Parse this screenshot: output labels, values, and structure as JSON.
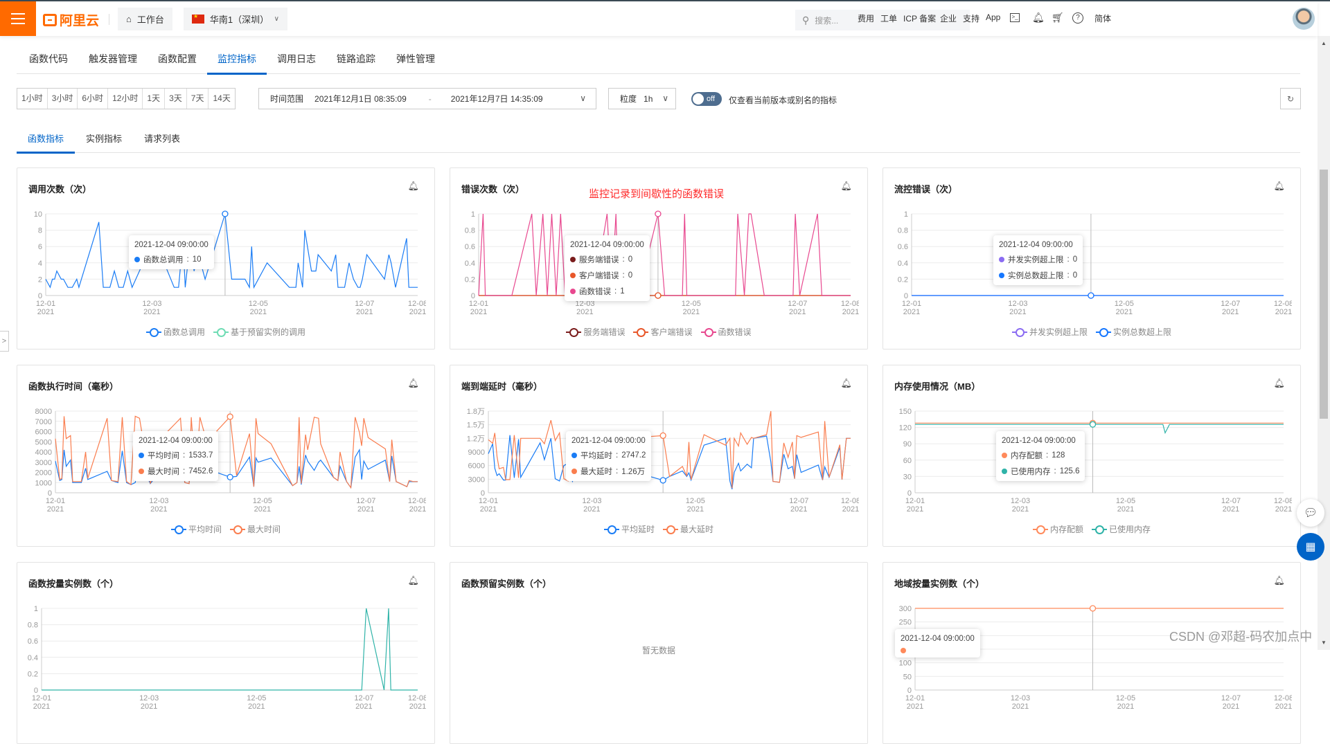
{
  "header": {
    "logo_text": "阿里云",
    "workbench": "工作台",
    "region": "华南1（深圳）",
    "search_placeholder": "搜索...",
    "nav": [
      "费用",
      "工单",
      "ICP 备案",
      "企业",
      "支持",
      "App"
    ],
    "language": "简体",
    "icons": [
      "terminal-icon",
      "bell-icon",
      "cart-icon",
      "help-icon"
    ]
  },
  "tabs": [
    {
      "label": "函数代码",
      "active": false
    },
    {
      "label": "触发器管理",
      "active": false
    },
    {
      "label": "函数配置",
      "active": false
    },
    {
      "label": "监控指标",
      "active": true
    },
    {
      "label": "调用日志",
      "active": false
    },
    {
      "label": "链路追踪",
      "active": false
    },
    {
      "label": "弹性管理",
      "active": false
    }
  ],
  "toolbar": {
    "quick_ranges": [
      "1小时",
      "3小时",
      "6小时",
      "12小时",
      "1天",
      "3天",
      "7天",
      "14天"
    ],
    "range_label": "时间范围",
    "range_start": "2021年12月1日 08:35:09",
    "range_sep": "-",
    "range_end": "2021年12月7日 14:35:09",
    "granularity_label": "粒度",
    "granularity_value": "1h",
    "toggle_state": "off",
    "toggle_label": "仅查看当前版本或别名的指标"
  },
  "subtabs": [
    {
      "label": "函数指标",
      "active": true
    },
    {
      "label": "实例指标",
      "active": false
    },
    {
      "label": "请求列表",
      "active": false
    }
  ],
  "watermark": "CSDN @邓超-码农加点中",
  "chart_data": [
    {
      "type": "line",
      "title": "调用次数（次）",
      "ylim": [
        0,
        10
      ],
      "yticks": [
        "0",
        "2",
        "4",
        "6",
        "8",
        "10"
      ],
      "xticks": [
        {
          "date": "2021-12-01",
          "l1": "12-01",
          "l2": "2021"
        },
        {
          "date": "2021-12-03",
          "l1": "12-03",
          "l2": "2021"
        },
        {
          "date": "2021-12-05",
          "l1": "12-05",
          "l2": "2021"
        },
        {
          "date": "2021-12-07",
          "l1": "12-07",
          "l2": "2021"
        },
        {
          "date": "2021-12-08",
          "l1": "12-08",
          "l2": "2021"
        }
      ],
      "x": [
        "12-01 00:00",
        "12-01 02:00",
        "12-01 03:00",
        "12-01 04:00",
        "12-01 05:00",
        "12-01 07:00",
        "12-01 08:00",
        "12-01 10:00",
        "12-01 12:00",
        "12-01 14:00",
        "12-01 15:00",
        "12-02 00:00",
        "12-02 02:00",
        "12-02 05:00",
        "12-02 07:00",
        "12-02 09:00",
        "12-02 11:00",
        "12-02 13:00",
        "12-02 15:00",
        "12-02 20:00",
        "12-03 04:00",
        "12-03 10:00",
        "12-03 12:00",
        "12-03 14:00",
        "12-03 15:00",
        "12-03 17:00",
        "12-03 19:00",
        "12-03 21:00",
        "12-04 00:00",
        "12-04 09:00",
        "12-04 12:00",
        "12-04 18:00",
        "12-04 20:00",
        "12-04 21:00",
        "12-04 22:00",
        "12-05 04:00",
        "12-05 14:00",
        "12-05 16:00",
        "12-05 17:00",
        "12-05 18:00",
        "12-05 20:00",
        "12-05 21:00",
        "12-06 00:00",
        "12-06 02:00",
        "12-06 03:00",
        "12-06 09:00",
        "12-06 11:00",
        "12-06 12:00",
        "12-06 15:00",
        "12-06 17:00",
        "12-06 19:00",
        "12-06 21:00",
        "12-06 22:00",
        "12-06 23:00",
        "12-07 01:00",
        "12-07 09:00",
        "12-07 11:00",
        "12-07 12:00",
        "12-07 14:00",
        "12-07 19:00",
        "12-07 20:00",
        "12-07 22:00",
        "12-08 00:00"
      ],
      "series": [
        {
          "name": "函数总调用",
          "color": "#1a7cf5",
          "values": [
            2,
            1,
            2,
            2,
            3,
            2,
            2,
            1,
            1,
            2,
            1,
            9,
            1,
            1,
            3,
            1,
            1,
            3,
            1,
            4,
            5,
            1,
            1,
            7,
            1,
            6,
            3,
            5,
            2,
            10,
            2,
            2,
            1,
            6,
            1,
            4,
            1,
            1,
            1,
            4,
            1,
            8,
            3,
            3,
            5,
            3,
            5,
            1,
            1,
            4,
            2,
            1,
            1,
            2,
            5,
            2,
            5,
            4,
            1,
            7,
            1,
            1,
            1
          ]
        },
        {
          "name": "基于预留实例的调用",
          "color": "#6fdcb4",
          "values": []
        }
      ],
      "tooltip": {
        "time": "2021-12-04 09:00:00",
        "rows": [
          {
            "label": "函数总调用",
            "value": "10",
            "color": "#1a7cf5"
          }
        ]
      },
      "highlight": "12-04 09:00"
    },
    {
      "type": "line",
      "title": "错误次数（次）",
      "annotation": "监控记录到间歇性的函数错误",
      "ylim": [
        0,
        1
      ],
      "yticks": [
        "0",
        "0.2",
        "0.4",
        "0.6",
        "0.8",
        "1"
      ],
      "series": [
        {
          "name": "服务端错误",
          "color": "#7a1c1c",
          "values": "zeros"
        },
        {
          "name": "客户端错误",
          "color": "#e8572a",
          "values": "zeros"
        },
        {
          "name": "函数错误",
          "color": "#e8488f",
          "values": [
            0,
            1,
            0,
            0,
            0,
            0,
            0,
            0,
            0,
            0,
            0,
            1,
            0,
            1,
            0,
            1,
            0,
            1,
            0,
            0,
            0,
            1,
            0,
            1,
            0,
            0,
            0,
            0,
            0,
            1,
            0,
            0,
            0,
            1,
            0,
            0,
            0,
            0,
            0,
            0,
            0,
            1,
            0,
            1,
            1,
            0,
            0,
            0,
            0,
            0,
            0,
            0,
            0,
            1,
            0,
            1,
            0,
            0,
            0,
            0,
            0,
            0,
            0
          ]
        }
      ],
      "tooltip": {
        "time": "2021-12-04 09:00:00",
        "rows": [
          {
            "label": "服务端错误",
            "value": "0",
            "color": "#7a1c1c"
          },
          {
            "label": "客户端错误",
            "value": "0",
            "color": "#e8572a"
          },
          {
            "label": "函数错误",
            "value": "1",
            "color": "#e8488f"
          }
        ]
      },
      "highlight": "12-04 09:00"
    },
    {
      "type": "line",
      "title": "流控错误（次）",
      "ylim": [
        0,
        1
      ],
      "yticks": [
        "0",
        "0.2",
        "0.4",
        "0.6",
        "0.8",
        "1"
      ],
      "series": [
        {
          "name": "并发实例超上限",
          "color": "#8b6cf2",
          "values": "zeros"
        },
        {
          "name": "实例总数超上限",
          "color": "#1677ff",
          "values": "zeros"
        }
      ],
      "tooltip": {
        "time": "2021-12-04 09:00:00",
        "rows": [
          {
            "label": "并发实例超上限",
            "value": "0",
            "color": "#8b6cf2"
          },
          {
            "label": "实例总数超上限",
            "value": "0",
            "color": "#1677ff"
          }
        ]
      },
      "highlight": "12-04 09:00"
    },
    {
      "type": "line",
      "title": "函数执行时间（毫秒）",
      "ylim": [
        0,
        8000
      ],
      "yticks": [
        "0",
        "1000",
        "2000",
        "3000",
        "4000",
        "5000",
        "6000",
        "7000",
        "8000"
      ],
      "series": [
        {
          "name": "平均时间",
          "color": "#1a7cf5",
          "values": [
            3100,
            1200,
            1300,
            4200,
            2600,
            3200,
            1000,
            1000,
            1000,
            2400,
            1300,
            2100,
            1200,
            1000,
            4100,
            1000,
            800,
            1000,
            3200,
            900,
            3000,
            3200,
            1000,
            900,
            3000,
            1800,
            3400,
            2800,
            2200,
            1533.7,
            1600,
            3500,
            600,
            3400,
            3000,
            3400,
            700,
            1000,
            2600,
            800,
            3700,
            3100,
            2200,
            3000,
            3200,
            1500,
            1200,
            2600,
            1100,
            500,
            3500,
            4200,
            1300,
            3100,
            2300,
            3200,
            1100,
            3600,
            1100,
            600,
            1100,
            1100,
            1100
          ]
        },
        {
          "name": "最大时间",
          "color": "#fa7d4e",
          "values": [
            5300,
            1300,
            1400,
            7500,
            5300,
            5600,
            1100,
            1100,
            1100,
            4000,
            1400,
            7300,
            1200,
            1100,
            7400,
            1100,
            800,
            7500,
            7300,
            900,
            6000,
            7300,
            1000,
            900,
            7400,
            1300,
            7400,
            5900,
            5400,
            7452.6,
            1700,
            5800,
            600,
            7300,
            5800,
            4800,
            700,
            1000,
            7400,
            900,
            5700,
            4200,
            7400,
            7300,
            4800,
            1500,
            1200,
            4000,
            1100,
            500,
            7400,
            5900,
            4600,
            7300,
            5400,
            4300,
            1100,
            5200,
            1100,
            600,
            1200,
            1100,
            1100
          ]
        }
      ],
      "tooltip": {
        "time": "2021-12-04 09:00:00",
        "rows": [
          {
            "label": "平均时间",
            "value": "1533.7",
            "color": "#1a7cf5"
          },
          {
            "label": "最大时间",
            "value": "7452.6",
            "color": "#fa7d4e"
          }
        ]
      },
      "highlight": "12-04 09:00"
    },
    {
      "type": "line",
      "title": "端到端延时（毫秒）",
      "ylim": [
        0,
        18000
      ],
      "yticks": [
        "0",
        "3000",
        "6000",
        "9000",
        "1.2万",
        "1.5万",
        "1.8万"
      ],
      "series": [
        {
          "name": "平均延时",
          "color": "#1a7cf5",
          "values": [
            8600,
            10800,
            5400,
            3800,
            4200,
            2800,
            2800,
            12700,
            3300,
            11800,
            3400,
            11000,
            7300,
            12000,
            3100,
            2600,
            6000,
            6500,
            2500,
            7600,
            3800,
            8000,
            7000,
            6000,
            7500,
            5500,
            6000,
            5000,
            4000,
            2747.2,
            3600,
            4800,
            3600,
            4400,
            2800,
            10500,
            12000,
            2600,
            800,
            4500,
            6500,
            4800,
            6300,
            5500,
            12000,
            12500,
            6800,
            2500,
            2300,
            8500,
            5300,
            5800,
            3100,
            8400,
            4500,
            6100,
            2800,
            5700,
            3400,
            10000,
            2900,
            12000,
            12000
          ]
        },
        {
          "name": "最大延时",
          "color": "#fa7d4e",
          "values": [
            11700,
            10900,
            13200,
            8000,
            5300,
            5600,
            2900,
            2900,
            12700,
            3300,
            12000,
            12000,
            10800,
            16000,
            11500,
            13200,
            3100,
            2600,
            12000,
            12200,
            10000,
            12500,
            12500,
            11000,
            12000,
            11500,
            12500,
            12000,
            12300,
            12600,
            3600,
            5800,
            3700,
            11200,
            2900,
            12800,
            10500,
            12000,
            1000,
            12000,
            10300,
            13200,
            10700,
            12200,
            12000,
            12800,
            18000,
            2500,
            2300,
            11000,
            7800,
            11200,
            3100,
            12600,
            12200,
            13400,
            2800,
            15800,
            3400,
            10600,
            2900,
            12000,
            12000
          ]
        }
      ],
      "tooltip": {
        "time": "2021-12-04 09:00:00",
        "rows": [
          {
            "label": "平均延时",
            "value": "2747.2",
            "color": "#1a7cf5"
          },
          {
            "label": "最大延时",
            "value": "1.26万",
            "color": "#fa7d4e"
          }
        ]
      },
      "highlight": "12-04 09:00"
    },
    {
      "type": "line",
      "title": "内存使用情况（MB）",
      "ylim": [
        0,
        150
      ],
      "yticks": [
        "0",
        "30",
        "60",
        "90",
        "120",
        "150"
      ],
      "series": [
        {
          "name": "内存配额",
          "color": "#ff8a5b",
          "values": "const:128"
        },
        {
          "name": "已使用内存",
          "color": "#2fb3a8",
          "values": "const:125.6",
          "dips": {
            "12-05 18:00": 110
          }
        }
      ],
      "tooltip": {
        "time": "2021-12-04 09:00:00",
        "rows": [
          {
            "label": "内存配额",
            "value": "128",
            "color": "#ff8a5b"
          },
          {
            "label": "已使用内存",
            "value": "125.6",
            "color": "#2fb3a8"
          }
        ]
      },
      "highlight": "12-04 09:00"
    },
    {
      "type": "line",
      "title": "函数按量实例数（个）",
      "ylim": [
        0,
        1
      ],
      "yticks": [
        "0",
        "0.2",
        "0.4",
        "0.6",
        "0.8",
        "1"
      ],
      "series": [
        {
          "name": "",
          "color": "#2fb3a8",
          "values": "zeros",
          "spikes": {
            "12-07 01:00": 1,
            "12-07 11:00": 1
          }
        }
      ]
    },
    {
      "type": "line",
      "title": "函数预留实例数（个）",
      "no_data": "暂无数据",
      "series": []
    },
    {
      "type": "line",
      "title": "地域按量实例数（个）",
      "ylim": [
        0,
        300
      ],
      "yticks": [
        "0",
        "50",
        "100",
        "150",
        "200",
        "250",
        "300"
      ],
      "series": [
        {
          "name": "",
          "color": "#ff8a5b",
          "values": "const:300"
        }
      ],
      "tooltip": {
        "time": "2021-12-04 09:00:00",
        "rows": [
          {
            "label": "",
            "value": "",
            "color": "#ff8a5b"
          }
        ]
      },
      "highlight": "12-04 09:00"
    }
  ]
}
